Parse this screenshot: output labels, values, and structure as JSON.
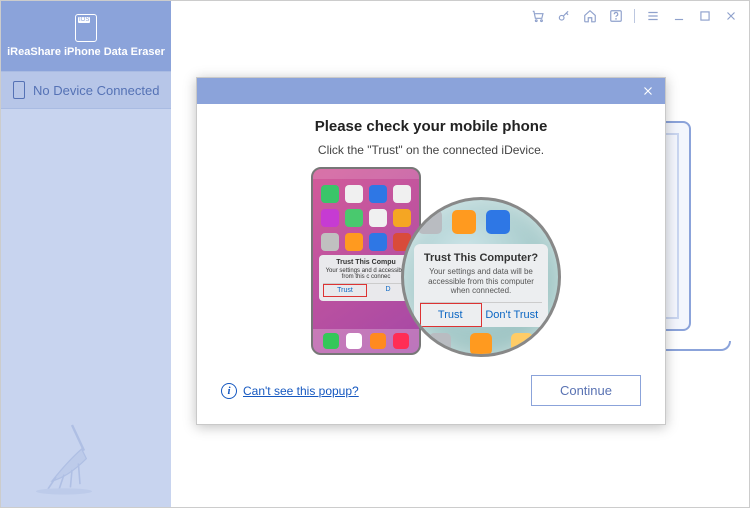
{
  "brand": "iReaShare iPhone Data Eraser",
  "sidebar": {
    "status": "No Device Connected"
  },
  "modal": {
    "title": "Please check your mobile phone",
    "subtitle": "Click the \"Trust\" on the connected iDevice.",
    "info_link": "Can't see this popup?",
    "continue": "Continue"
  },
  "trust_dialog": {
    "small_title": "Trust This Compu",
    "small_text": "Your settings and d   accessible from this c   connec",
    "small_trust": "Trust",
    "small_other": "D",
    "big_title": "Trust This Computer?",
    "big_text": "Your settings and data will be accessible from this computer when connected.",
    "big_trust": "Trust",
    "big_donttrust": "Don't Trust"
  },
  "icon_colors": {
    "row1": [
      "#3ac569",
      "#f0f0f0",
      "#2e77e5",
      "#f0f0f0"
    ],
    "row2": [
      "#c63bd3",
      "#49c96e",
      "#f0f0f0",
      "#f5a623"
    ],
    "row3": [
      "#c0c0c0",
      "#ff9a1f",
      "#2e77e5",
      "#d94b3a"
    ],
    "dock": [
      "#34c759",
      "#ffffff",
      "#ff8a1f",
      "#ff2d55"
    ],
    "mag_top": [
      "#b9bcc1",
      "#ff9a1f",
      "#2e77e5"
    ],
    "mag_dock": [
      "#b9bcc1",
      "#ff9a1f",
      "#ffcc66"
    ]
  }
}
